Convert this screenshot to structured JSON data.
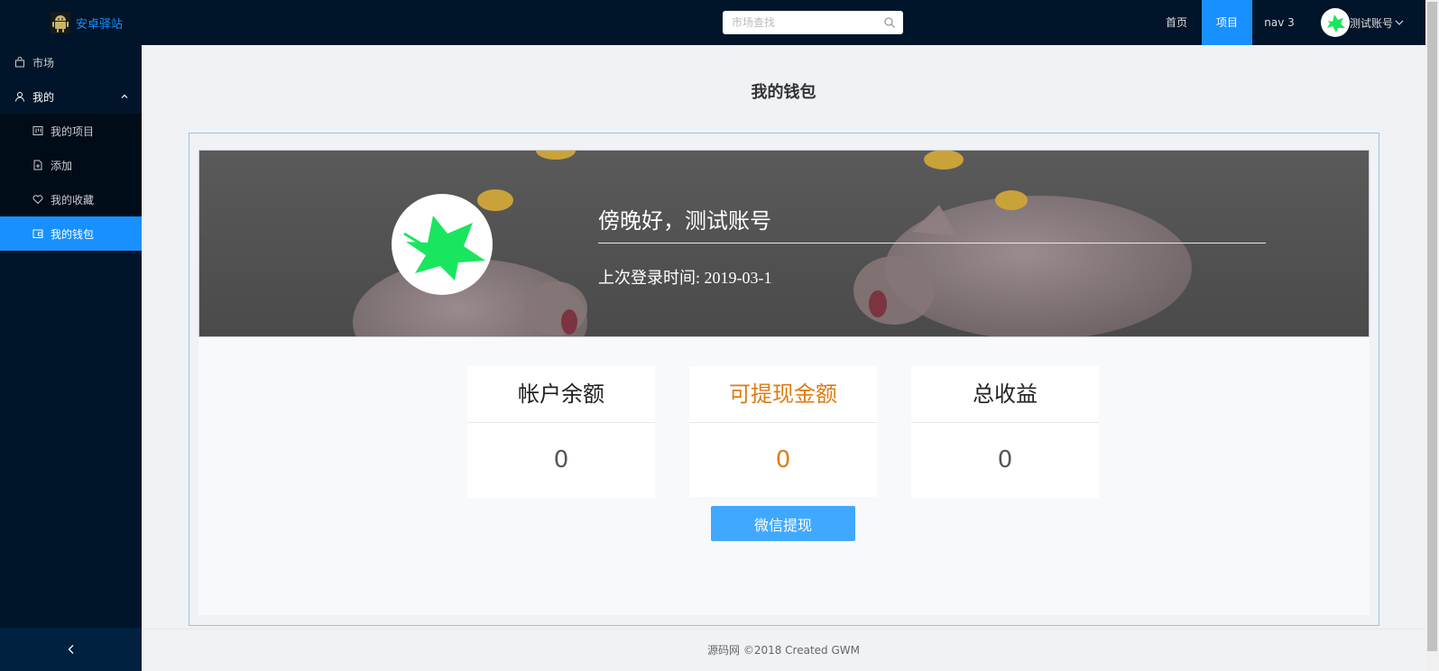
{
  "header": {
    "brand": "安卓驿站",
    "search_placeholder": "市场查找",
    "nav": [
      "首页",
      "项目",
      "nav 3"
    ],
    "user_name": "测试账号"
  },
  "sidebar": {
    "items": [
      {
        "label": "市场",
        "icon": "shop-icon"
      },
      {
        "label": "我的",
        "icon": "user-icon"
      },
      {
        "label": "我的项目",
        "icon": "project-icon"
      },
      {
        "label": "添加",
        "icon": "file-add-icon"
      },
      {
        "label": "我的收藏",
        "icon": "heart-icon"
      },
      {
        "label": "我的钱包",
        "icon": "wallet-icon"
      }
    ]
  },
  "page": {
    "title": "我的钱包",
    "greeting": "傍晚好，测试账号",
    "last_login": "上次登录时间: 2019-03-1",
    "stats": [
      {
        "label": "帐户余额",
        "value": "0"
      },
      {
        "label": "可提现金额",
        "value": "0"
      },
      {
        "label": "总收益",
        "value": "0"
      }
    ],
    "withdraw_button": "微信提现"
  },
  "footer": {
    "text": "源码网 ©2018 Created GWM"
  },
  "colors": {
    "header_bg": "#001529",
    "accent": "#1890ff",
    "withdraw_accent": "#e07b13",
    "button": "#40a9ff"
  }
}
